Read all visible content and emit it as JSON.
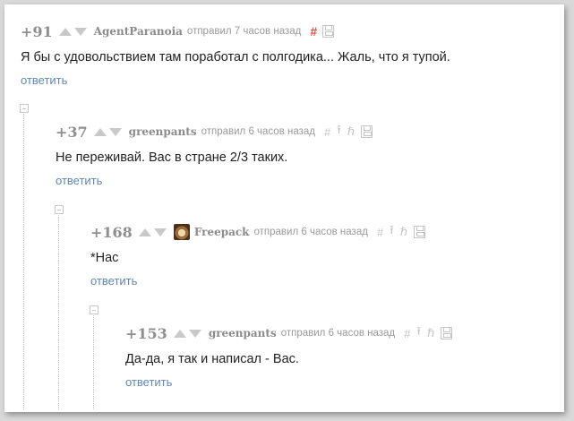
{
  "theme": {
    "accent_hash": "#e34a3d",
    "link": "#5f87b5"
  },
  "comments": [
    {
      "score": "+91",
      "author": "AgentParanoia",
      "meta": "отправил 7 часов назад",
      "hash": "#",
      "text": "Я бы с удовольствием там поработал с полгодика... Жаль, что я тупой.",
      "reply": "ответить"
    },
    {
      "score": "+37",
      "author": "greenpants",
      "meta": "отправил 6 часов назад",
      "hash": "#",
      "text": "Не переживай. Вас в стране 2/3 таких.",
      "reply": "ответить"
    },
    {
      "score": "+168",
      "author": "Freepack",
      "meta": "отправил 6 часов назад",
      "hash": "#",
      "text": "*Нас",
      "reply": "ответить"
    },
    {
      "score": "+153",
      "author": "greenpants",
      "meta": "отправил 6 часов назад",
      "hash": "#",
      "text": "Да-да, я так и написал - Вас.",
      "reply": "ответить"
    }
  ],
  "icons": [
    "upvote-icon",
    "downvote-icon",
    "link-icon",
    "jump-to-parent-icon",
    "parent-branch-icon",
    "save-icon",
    "collapse-icon",
    "avatar"
  ]
}
